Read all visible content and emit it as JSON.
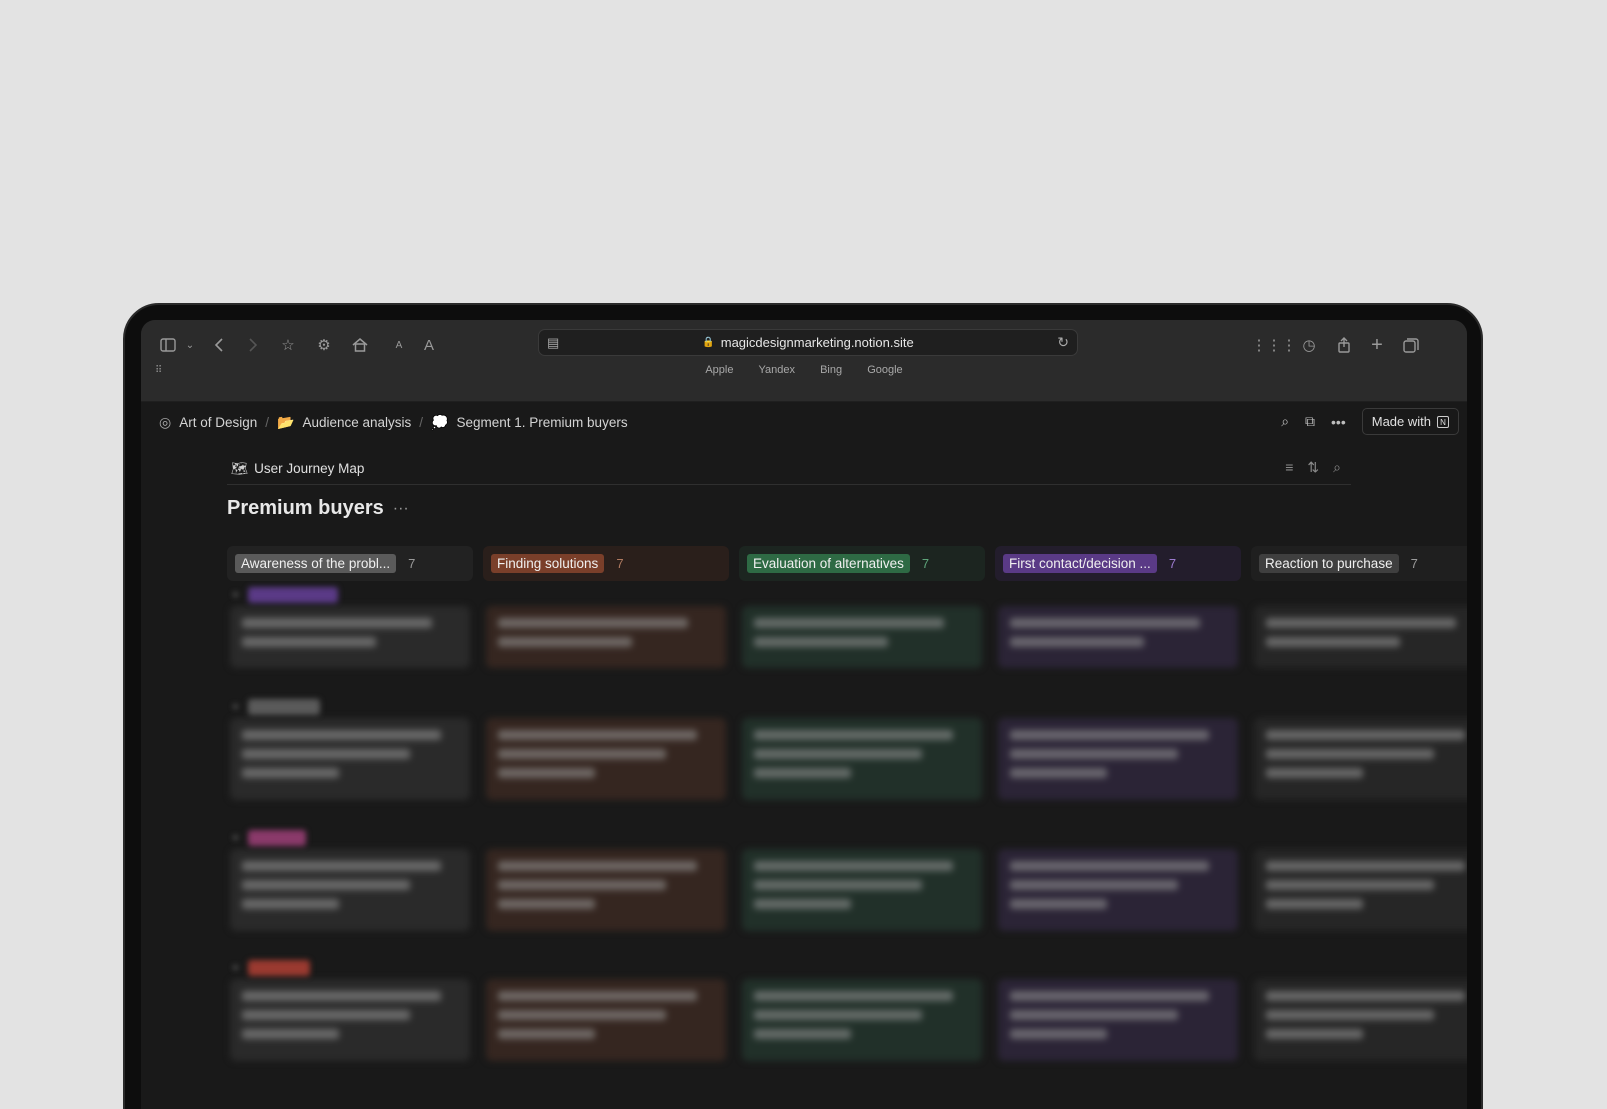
{
  "browser": {
    "url": "magicdesignmarketing.notion.site",
    "favorites": [
      "Apple",
      "Yandex",
      "Bing",
      "Google"
    ],
    "font_small": "A",
    "font_large": "A"
  },
  "breadcrumb": {
    "items": [
      {
        "label": "Art of Design",
        "icon": "target-icon"
      },
      {
        "label": "Audience analysis",
        "icon": "folder-icon"
      },
      {
        "label": "Segment 1. Premium buyers",
        "icon": "speech-bubble-icon"
      }
    ],
    "separator": "/"
  },
  "topbar": {
    "made_with": "Made with"
  },
  "database": {
    "view_name": "User Journey Map",
    "title": "Premium buyers"
  },
  "columns": [
    {
      "label": "Awareness of the probl...",
      "count": "7",
      "tag_color": "#5a5a5a",
      "bg": "#222222",
      "count_color": "#9a9a9a",
      "card_bg": "#2a2a2a"
    },
    {
      "label": "Finding solutions",
      "count": "7",
      "tag_color": "#7a3f2a",
      "bg": "#2a1f1b",
      "count_color": "#b07a60",
      "card_bg": "#352620"
    },
    {
      "label": "Evaluation of alternatives",
      "count": "7",
      "tag_color": "#2e6a44",
      "bg": "#1c2520",
      "count_color": "#5ea57a",
      "card_bg": "#213029"
    },
    {
      "label": "First contact/decision ...",
      "count": "7",
      "tag_color": "#5a3a86",
      "bg": "#231d2c",
      "count_color": "#9c7bd0",
      "card_bg": "#2b2436"
    },
    {
      "label": "Reaction to purchase",
      "count": "7",
      "tag_color": "#3f3f3f",
      "bg": "#1f1f1f",
      "count_color": "#9a9a9a",
      "card_bg": "#262626"
    }
  ],
  "groups": [
    {
      "tag_color": "#5a3a86"
    },
    {
      "tag_color": "#5a5a5a"
    },
    {
      "tag_color": "#8a3a6a"
    },
    {
      "tag_color": "#9a3a30"
    }
  ]
}
